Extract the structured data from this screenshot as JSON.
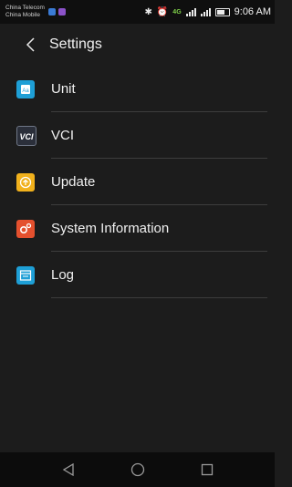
{
  "status_bar": {
    "carrier1": "China Telecom",
    "carrier2": "China Mobile",
    "network": "4G",
    "time": "9:06 AM",
    "icons": [
      "bluetooth-icon",
      "alarm-icon",
      "signal-icon",
      "battery-icon"
    ]
  },
  "app_bar": {
    "title": "Settings",
    "back_icon": "chevron-left-icon"
  },
  "items": [
    {
      "label": "Unit",
      "icon": "unit-icon",
      "color": "#1e9fd6"
    },
    {
      "label": "VCI",
      "icon": "vci-icon",
      "color": "#2b2f3a"
    },
    {
      "label": "Update",
      "icon": "update-icon",
      "color": "#f1b11c"
    },
    {
      "label": "System Information",
      "icon": "system-info-icon",
      "color": "#e4502e"
    },
    {
      "label": "Log",
      "icon": "log-icon",
      "color": "#1e9fd6"
    }
  ],
  "nav_bar": {
    "icons": [
      "back-triangle-icon",
      "home-circle-icon",
      "recents-square-icon"
    ]
  }
}
